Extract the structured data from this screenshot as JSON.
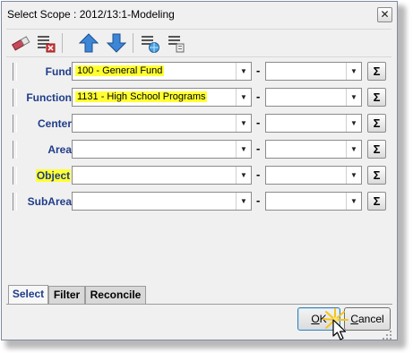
{
  "window": {
    "title": "Select Scope : 2012/13:1-Modeling",
    "close_glyph": "✕"
  },
  "toolbar": {
    "buttons": [
      {
        "icon": "eraser-icon"
      },
      {
        "icon": "list-delete-icon"
      },
      {
        "icon": "arrow-up-icon"
      },
      {
        "icon": "arrow-down-icon"
      },
      {
        "icon": "list-globe-icon"
      },
      {
        "icon": "list-copy-icon"
      }
    ]
  },
  "rows": [
    {
      "label": "Fund",
      "label_highlighted": false,
      "value": "100 - General Fund",
      "value_highlighted": true,
      "range_value": ""
    },
    {
      "label": "Function",
      "label_highlighted": false,
      "value": "1131 - High School Programs",
      "value_highlighted": true,
      "range_value": ""
    },
    {
      "label": "Center",
      "label_highlighted": false,
      "value": "",
      "value_highlighted": false,
      "range_value": ""
    },
    {
      "label": "Area",
      "label_highlighted": false,
      "value": "",
      "value_highlighted": false,
      "range_value": ""
    },
    {
      "label": "Object",
      "label_highlighted": true,
      "value": "",
      "value_highlighted": false,
      "range_value": ""
    },
    {
      "label": "SubArea",
      "label_highlighted": false,
      "value": "",
      "value_highlighted": false,
      "range_value": ""
    }
  ],
  "glyphs": {
    "dash": "-",
    "sigma": "Σ",
    "dropdown": "▼"
  },
  "tabs": [
    {
      "label": "Select",
      "active": true
    },
    {
      "label": "Filter",
      "active": false
    },
    {
      "label": "Reconcile",
      "active": false
    }
  ],
  "buttons": {
    "ok": {
      "mnemonic": "O",
      "rest": "K"
    },
    "cancel": {
      "mnemonic": "C",
      "rest": "ancel"
    }
  },
  "colors": {
    "label": "#1f3c8a",
    "highlight": "#ffff33",
    "click_burst": "#f5c518"
  }
}
